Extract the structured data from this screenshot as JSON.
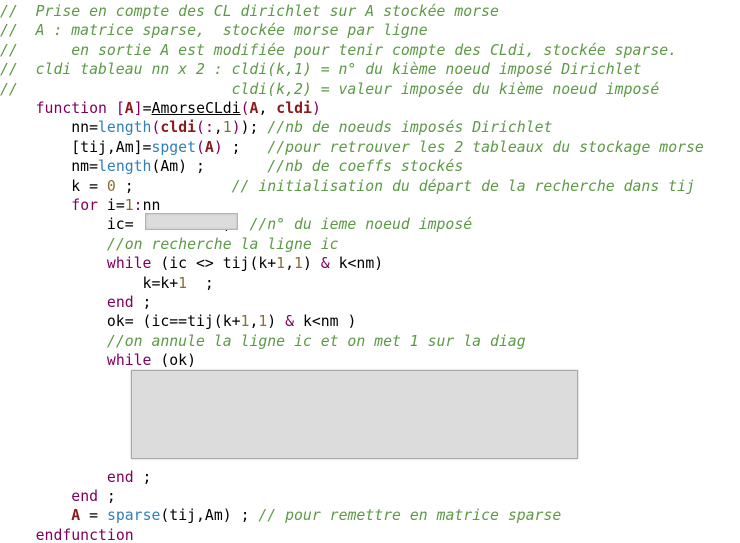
{
  "lines": [
    [
      {
        "text": "//  Prise en compte des CL dirichlet sur A stockée morse",
        "cls": "c"
      }
    ],
    [
      {
        "text": "//  A : matrice sparse,  stockée morse par ligne",
        "cls": "c"
      }
    ],
    [
      {
        "text": "//      en sortie A est modifiée pour tenir compte des CLdi, stockée sparse.",
        "cls": "c"
      }
    ],
    [
      {
        "text": "//  cldi tableau nn x 2 : cldi(k,1) = n° du kième noeud imposé Dirichlet",
        "cls": "c"
      }
    ],
    [
      {
        "text": "//                        cldi(k,2) = valeur imposée du kième noeud imposé",
        "cls": "c"
      }
    ],
    [
      {
        "text": "    ",
        "cls": "t"
      },
      {
        "text": "function",
        "cls": "k"
      },
      {
        "text": " ",
        "cls": "t"
      },
      {
        "text": "[",
        "cls": "k"
      },
      {
        "text": "A",
        "cls": "b"
      },
      {
        "text": "]",
        "cls": "k"
      },
      {
        "text": "=",
        "cls": "t"
      },
      {
        "text": "AmorseCLdi",
        "cls": "u"
      },
      {
        "text": "(",
        "cls": "k"
      },
      {
        "text": "A",
        "cls": "b"
      },
      {
        "text": ", ",
        "cls": "t"
      },
      {
        "text": "cldi",
        "cls": "b"
      },
      {
        "text": ")",
        "cls": "k"
      }
    ],
    [
      {
        "text": "        nn=",
        "cls": "t"
      },
      {
        "text": "length",
        "cls": "f"
      },
      {
        "text": "(",
        "cls": "k"
      },
      {
        "text": "cldi",
        "cls": "b"
      },
      {
        "text": "(",
        "cls": "k"
      },
      {
        "text": ":",
        "cls": "k"
      },
      {
        "text": ",",
        "cls": "t"
      },
      {
        "text": "1",
        "cls": "n"
      },
      {
        "text": ")",
        "cls": "k"
      },
      {
        "text": "); ",
        "cls": "t"
      },
      {
        "text": "//nb de noeuds imposés Dirichlet",
        "cls": "c"
      }
    ],
    [
      {
        "text": "        [tij,Am]=",
        "cls": "t"
      },
      {
        "text": "spget",
        "cls": "f"
      },
      {
        "text": "(",
        "cls": "k"
      },
      {
        "text": "A",
        "cls": "b"
      },
      {
        "text": ")",
        "cls": "k"
      },
      {
        "text": " ;   ",
        "cls": "t"
      },
      {
        "text": "//pour retrouver les 2 tableaux du stockage morse",
        "cls": "c"
      }
    ],
    [
      {
        "text": "        nm=",
        "cls": "t"
      },
      {
        "text": "length",
        "cls": "f"
      },
      {
        "text": "(Am) ;       ",
        "cls": "t"
      },
      {
        "text": "//nb de coeffs stockés",
        "cls": "c"
      }
    ],
    [
      {
        "text": "        k = ",
        "cls": "t"
      },
      {
        "text": "0",
        "cls": "n"
      },
      {
        "text": " ;           ",
        "cls": "t"
      },
      {
        "text": "// initialisation du départ de la recherche dans tij",
        "cls": "c"
      }
    ],
    [
      {
        "text": "        ",
        "cls": "t"
      },
      {
        "text": "for",
        "cls": "k"
      },
      {
        "text": " i=",
        "cls": "t"
      },
      {
        "text": "1",
        "cls": "n"
      },
      {
        "text": ":",
        "cls": "k"
      },
      {
        "text": "nn",
        "cls": "t"
      }
    ],
    [
      {
        "text": "            ic=          ;  ",
        "cls": "t"
      },
      {
        "text": "//n° du ieme noeud imposé",
        "cls": "c"
      }
    ],
    [
      {
        "text": "            ",
        "cls": "t"
      },
      {
        "text": "//on recherche la ligne ic",
        "cls": "c"
      }
    ],
    [
      {
        "text": "            ",
        "cls": "t"
      },
      {
        "text": "while",
        "cls": "k"
      },
      {
        "text": " (ic <> tij(k+",
        "cls": "t"
      },
      {
        "text": "1",
        "cls": "n"
      },
      {
        "text": ",",
        "cls": "t"
      },
      {
        "text": "1",
        "cls": "n"
      },
      {
        "text": ") ",
        "cls": "t"
      },
      {
        "text": "&",
        "cls": "k"
      },
      {
        "text": " k<nm)",
        "cls": "t"
      }
    ],
    [
      {
        "text": "                k=k+",
        "cls": "t"
      },
      {
        "text": "1",
        "cls": "n"
      },
      {
        "text": "  ;",
        "cls": "t"
      }
    ],
    [
      {
        "text": "            ",
        "cls": "t"
      },
      {
        "text": "end",
        "cls": "k"
      },
      {
        "text": " ;",
        "cls": "t"
      }
    ],
    [
      {
        "text": "            ok= (ic==tij(k+",
        "cls": "t"
      },
      {
        "text": "1",
        "cls": "n"
      },
      {
        "text": ",",
        "cls": "t"
      },
      {
        "text": "1",
        "cls": "n"
      },
      {
        "text": ") ",
        "cls": "t"
      },
      {
        "text": "&",
        "cls": "k"
      },
      {
        "text": " k<nm )",
        "cls": "t"
      }
    ],
    [
      {
        "text": "            ",
        "cls": "t"
      },
      {
        "text": "//on annule la ligne ic et on met 1 sur la diag",
        "cls": "c"
      }
    ],
    [
      {
        "text": "            ",
        "cls": "t"
      },
      {
        "text": "while",
        "cls": "k"
      },
      {
        "text": " (ok)",
        "cls": "t"
      }
    ],
    [
      {
        "text": "",
        "cls": "t"
      }
    ],
    [
      {
        "text": "",
        "cls": "t"
      }
    ],
    [
      {
        "text": "",
        "cls": "t"
      }
    ],
    [
      {
        "text": "",
        "cls": "t"
      }
    ],
    [
      {
        "text": "",
        "cls": "t"
      }
    ],
    [
      {
        "text": "            ",
        "cls": "t"
      },
      {
        "text": "end",
        "cls": "k"
      },
      {
        "text": " ;",
        "cls": "t"
      }
    ],
    [
      {
        "text": "        ",
        "cls": "t"
      },
      {
        "text": "end",
        "cls": "k"
      },
      {
        "text": " ;",
        "cls": "t"
      }
    ],
    [
      {
        "text": "        ",
        "cls": "t"
      },
      {
        "text": "A",
        "cls": "b"
      },
      {
        "text": " = ",
        "cls": "t"
      },
      {
        "text": "sparse",
        "cls": "f"
      },
      {
        "text": "(tij,Am) ; ",
        "cls": "t"
      },
      {
        "text": "// pour remettre en matrice sparse",
        "cls": "c"
      }
    ],
    [
      {
        "text": "    ",
        "cls": "t"
      },
      {
        "text": "endfunction",
        "cls": "k"
      }
    ]
  ]
}
